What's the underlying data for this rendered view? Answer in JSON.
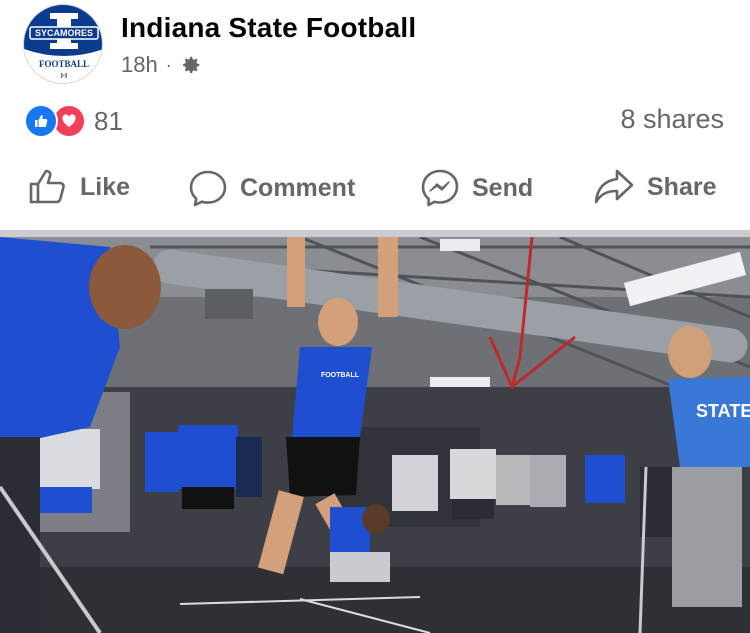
{
  "post": {
    "page_name": "Indiana State Football",
    "time": "18h",
    "separator": "·",
    "privacy_icon": "gear-icon"
  },
  "avatar": {
    "top_text": "SYCAMORES",
    "bottom_text": "FOOTBALL",
    "brand_color": "#0b3b8c"
  },
  "stats": {
    "reaction_count": "81",
    "shares": "8 shares",
    "reactions": [
      "like-icon",
      "love-icon"
    ]
  },
  "actions": [
    {
      "label": "Like",
      "icon": "thumbs-up-icon"
    },
    {
      "label": "Comment",
      "icon": "comment-bubble-icon"
    },
    {
      "label": "Send",
      "icon": "messenger-icon"
    },
    {
      "label": "Share",
      "icon": "share-arrow-icon"
    }
  ],
  "photo": {
    "jersey_text": "FOOTBALL",
    "shirt_text_right": "STATE"
  },
  "colors": {
    "like_blue": "#1877f2",
    "love_red": "#f33e58",
    "secondary_text": "#65676b",
    "team_blue": "#1f4fd1"
  }
}
